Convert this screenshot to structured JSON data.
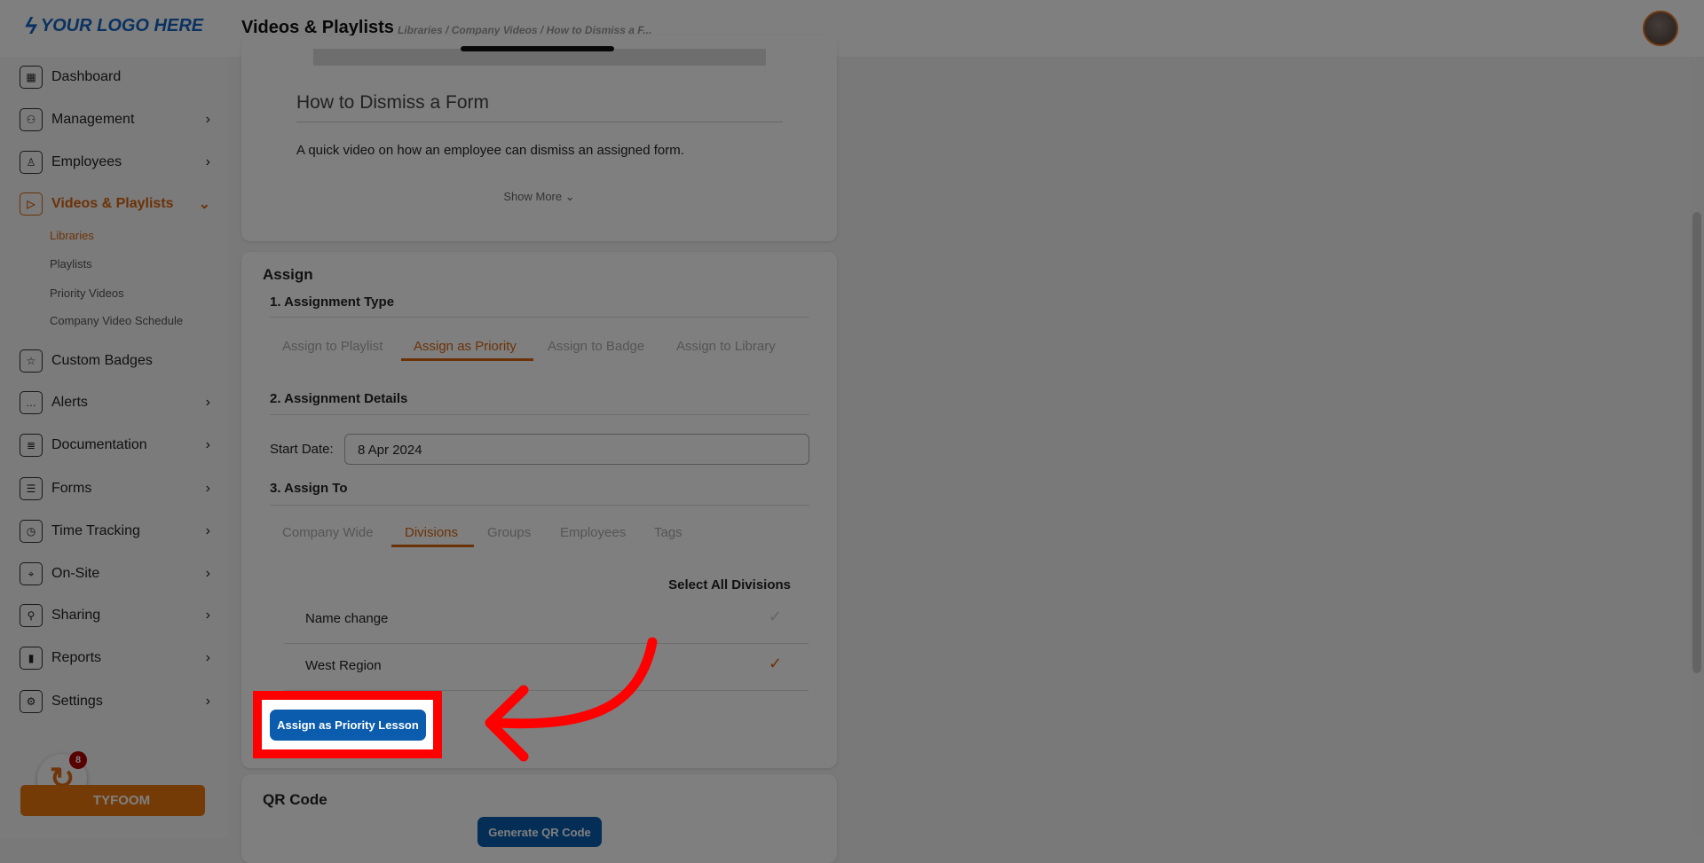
{
  "header": {
    "logo": "YOUR LOGO HERE",
    "title": "Videos & Playlists",
    "breadcrumb": "Libraries  /  Company Videos  /  How to Dismiss a F..."
  },
  "sidebar": {
    "items": [
      {
        "label": "Dashboard",
        "icon": "dashboard-icon"
      },
      {
        "label": "Management",
        "icon": "people-icon"
      },
      {
        "label": "Employees",
        "icon": "person-icon"
      },
      {
        "label": "Videos & Playlists",
        "icon": "play-icon"
      },
      {
        "label": "Custom Badges",
        "icon": "badge-icon"
      },
      {
        "label": "Alerts",
        "icon": "chat-icon"
      },
      {
        "label": "Documentation",
        "icon": "document-icon"
      },
      {
        "label": "Forms",
        "icon": "list-icon"
      },
      {
        "label": "Time Tracking",
        "icon": "stopwatch-icon"
      },
      {
        "label": "On-Site",
        "icon": "location-icon"
      },
      {
        "label": "Sharing",
        "icon": "share-icon"
      },
      {
        "label": "Reports",
        "icon": "chart-icon"
      },
      {
        "label": "Settings",
        "icon": "gear-icon"
      }
    ],
    "subitems": [
      "Libraries",
      "Playlists",
      "Priority Videos",
      "Company Video Schedule"
    ],
    "tyfoom": "TYFOOM",
    "chat_badge": "8"
  },
  "video": {
    "title": "How to Dismiss a Form",
    "description": "A quick video on how an employee can dismiss an assigned form.",
    "show_more": "Show More ⌄"
  },
  "assign": {
    "title": "Assign",
    "step1": "1. Assignment Type",
    "type_tabs": [
      "Assign to Playlist",
      "Assign as Priority",
      "Assign to Badge",
      "Assign to Library"
    ],
    "step2": "2. Assignment Details",
    "start_label": "Start Date:",
    "start_value": "8 Apr 2024",
    "step3": "3. Assign To",
    "to_tabs": [
      "Company Wide",
      "Divisions",
      "Groups",
      "Employees",
      "Tags"
    ],
    "select_all": "Select All Divisions",
    "divisions": [
      {
        "name": "Name change",
        "checked": false
      },
      {
        "name": "West Region",
        "checked": true
      }
    ],
    "submit": "Assign as Priority Lesson"
  },
  "qr": {
    "title": "QR Code",
    "button": "Generate QR Code"
  },
  "colors": {
    "accent": "#d9650f",
    "primary": "#0b5cad",
    "highlight": "#ff0000"
  }
}
